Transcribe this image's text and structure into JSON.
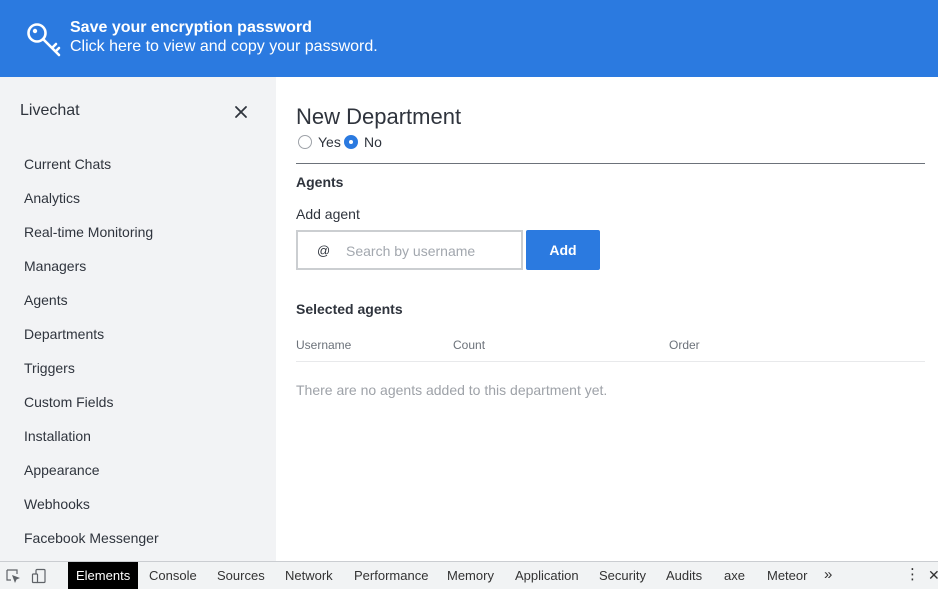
{
  "banner": {
    "title": "Save your encryption password",
    "subtitle": "Click here to view and copy your password.",
    "icon": "key-icon",
    "background": "#2b7ae0"
  },
  "sidebar": {
    "title": "Livechat",
    "close_icon": "close-icon",
    "items": [
      {
        "label": "Current Chats"
      },
      {
        "label": "Analytics"
      },
      {
        "label": "Real-time Monitoring"
      },
      {
        "label": "Managers"
      },
      {
        "label": "Agents"
      },
      {
        "label": "Departments"
      },
      {
        "label": "Triggers"
      },
      {
        "label": "Custom Fields"
      },
      {
        "label": "Installation"
      },
      {
        "label": "Appearance"
      },
      {
        "label": "Webhooks"
      },
      {
        "label": "Facebook Messenger"
      }
    ]
  },
  "main": {
    "title": "New Department",
    "enabled_options": [
      {
        "label": "Yes",
        "checked": false
      },
      {
        "label": "No",
        "checked": true
      }
    ],
    "agents_section": "Agents",
    "add_agent_label": "Add agent",
    "search": {
      "prefix": "@",
      "placeholder": "Search by username",
      "value": ""
    },
    "add_button": "Add",
    "selected_agents_title": "Selected agents",
    "columns": [
      "Username",
      "Count",
      "Order"
    ],
    "empty_message": "There are no agents added to this department yet.",
    "accent": "#2b7ae0"
  },
  "devtools": {
    "tabs": [
      {
        "label": "Elements",
        "active": true
      },
      {
        "label": "Console",
        "active": false
      },
      {
        "label": "Sources",
        "active": false
      },
      {
        "label": "Network",
        "active": false
      },
      {
        "label": "Performance",
        "active": false
      },
      {
        "label": "Memory",
        "active": false
      },
      {
        "label": "Application",
        "active": false
      },
      {
        "label": "Security",
        "active": false
      },
      {
        "label": "Audits",
        "active": false
      },
      {
        "label": "axe",
        "active": false
      },
      {
        "label": "Meteor",
        "active": false
      }
    ],
    "more": "»",
    "menu": "⋮",
    "close": "✕"
  }
}
